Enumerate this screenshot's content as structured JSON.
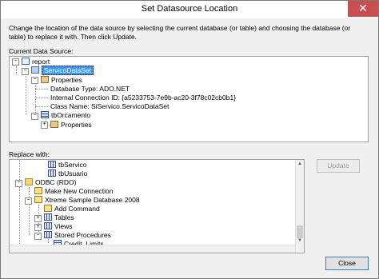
{
  "window": {
    "title": "Set Datasource Location",
    "close_glyph": "✕"
  },
  "instructions": "Change the location of the data source by selecting the current database (or table) and choosing the database (or table) to replace it with.  Then click Update.",
  "current_label": "Current Data Source:",
  "current_tree": {
    "report": "report",
    "dataset": "ServicoDataSet",
    "properties": "Properties",
    "db_type": "Database Type: ADO.NET",
    "conn_id": "Internal Connection ID: {a5233753-7e9b-ac20-3f78c02cb0b1}",
    "class_name": "Class Name: SiServico.ServicoDataSet",
    "table": "tbOrcamento",
    "table_props": "Properties"
  },
  "replace_label": "Replace with:",
  "replace_tree": {
    "tb_servico": "tbServico",
    "tb_usuario": "tbUsuario",
    "odbc": "ODBC (RDO)",
    "make_new": "Make New Connection",
    "xtreme": "Xtreme Sample Database 2008",
    "add_command": "Add Command",
    "tables": "Tables",
    "views": "Views",
    "stored_procs": "Stored Procedures",
    "credit_limits": "Credit_Limits"
  },
  "buttons": {
    "update": "Update",
    "close": "Close"
  },
  "icons": {
    "report": "report-icon",
    "dataset": "dataset-icon",
    "folder": "folder-icon",
    "table": "table-icon",
    "properties": "properties-icon",
    "command": "command-icon"
  }
}
